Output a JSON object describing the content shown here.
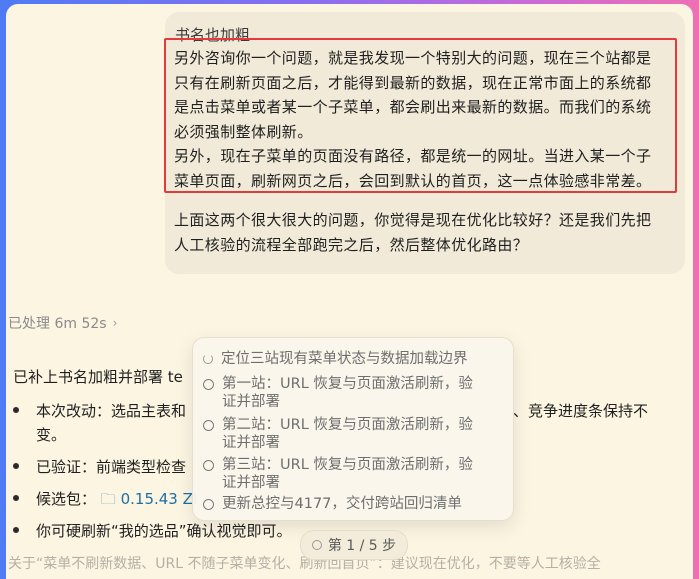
{
  "message": {
    "title": "书名也加粗",
    "highlighted_lines": [
      "另外咨询你一个问题，就是我发现一个特别大的问题，现在三个站都是",
      "只有在刷新页面之后，才能得到最新的数据，现在正常市面上的系统都",
      "是点击菜单或者某一个子菜单，都会刷出来最新的数据。而我们的系统",
      "必须强制整体刷新。",
      "另外，现在子菜单的页面没有路径，都是统一的网址。当进入某一个子",
      "菜单页面，刷新网页之后，会回到默认的首页，这一点体验感非常差。"
    ],
    "question_lines": [
      "上面这两个很大很大的问题，你觉得是现在优化比较好？还是我们先把",
      "人工核验的流程全部跑完之后，然后整体优化路由？"
    ]
  },
  "processed": {
    "label": "已处理 6m 52s",
    "chevron": "›"
  },
  "reply": {
    "intro": "已补上书名加粗并部署 te",
    "b1_start": "本次改动：选品主表和",
    "b1_end": "、竞争进度条保持不",
    "b1_line2": "变。",
    "b2": "已验证：前端类型检查",
    "b3_label": "候选包：",
    "b3_pkg": "0.15.43 ZI",
    "b4": "你可硬刷新“我的选品”确认视觉即可。",
    "bottom": "关于“菜单不刷新数据、URL 不随子菜单变化、刷新回首页”：建议现在优化，不要等人工核验全"
  },
  "steps": [
    {
      "lines": [
        "定位三站现有菜单状态与数据加载边界"
      ],
      "state": "in-progress"
    },
    {
      "lines": [
        "第一站：URL 恢复与页面激活刷新，验",
        "证并部署"
      ],
      "state": "pending"
    },
    {
      "lines": [
        "第二站：URL 恢复与页面激活刷新，验",
        "证并部署"
      ],
      "state": "pending"
    },
    {
      "lines": [
        "第三站：URL 恢复与页面激活刷新，验",
        "证并部署"
      ],
      "state": "pending"
    },
    {
      "lines": [
        "更新总控与4177，交付跨站回归清单"
      ],
      "state": "pending"
    }
  ],
  "pager": {
    "label": "第 1 / 5 步"
  }
}
